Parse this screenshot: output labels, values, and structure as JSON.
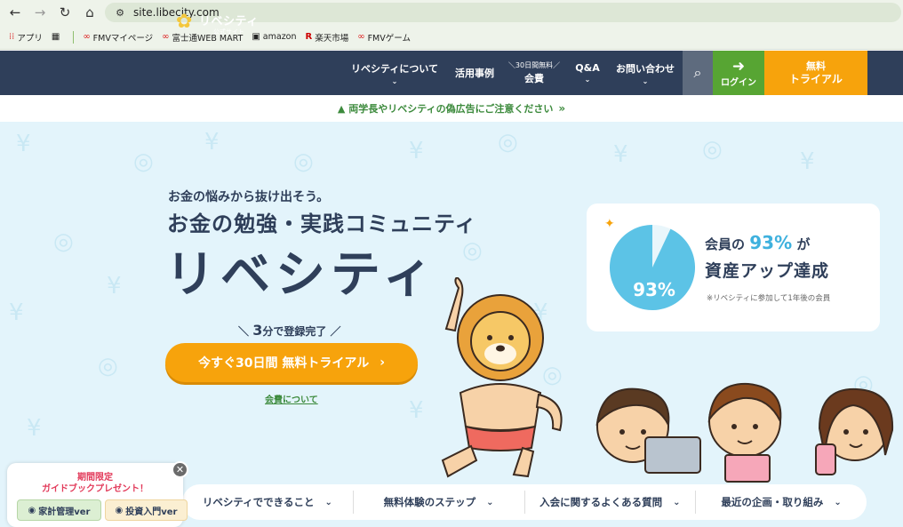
{
  "browser": {
    "url": "site.libecity.com",
    "bookmarks": [
      {
        "label": "アプリ",
        "icon": "apps-grid-icon"
      },
      {
        "label": "",
        "icon": "tab-groups-icon"
      },
      {
        "label": "FMVマイページ",
        "icon": "fmv-icon"
      },
      {
        "label": "富士通WEB MART",
        "icon": "fmv-icon"
      },
      {
        "label": "amazon",
        "icon": "amazon-icon"
      },
      {
        "label": "楽天市場",
        "icon": "rakuten-icon"
      },
      {
        "label": "FMVゲーム",
        "icon": "fmv-icon"
      }
    ]
  },
  "header": {
    "logo_name": "リベシティ",
    "logo_sub": "公式サイト",
    "nav": {
      "about": "リベシティについて",
      "cases": "活用事例",
      "fee_pre": "＼30日間無料／",
      "fee": "会費",
      "qa": "Q&A",
      "contact": "お問い合わせ"
    },
    "login": "ログイン",
    "trial_l1": "無料",
    "trial_l2": "トライアル"
  },
  "warning": {
    "text": "両学長やリベシティの偽広告にご注意ください"
  },
  "hero": {
    "tagline": "お金の悩みから抜け出そう。",
    "headline": "お金の勉強・実践コミュニティ",
    "title": "リベシティ",
    "reg_num": "3",
    "reg_text": "分で登録完了",
    "cta": "今すぐ30日間 無料トライアル",
    "fee_link": "会費について"
  },
  "stat": {
    "pie_label": "93%",
    "line1_pre": "会員の",
    "line1_pct": "93%",
    "line1_post": "が",
    "line2": "資産アップ達成",
    "note": "※リベシティに参加して1年後の会員",
    "value": 0.93
  },
  "bottom_nav": [
    "リベシティでできること",
    "無料体験のステップ",
    "入会に関するよくある質問",
    "最近の企画・取り組み"
  ],
  "popup": {
    "line1": "期間限定",
    "line2": "ガイドブックプレゼント！",
    "btn1": "家計管理ver",
    "btn2": "投資入門ver"
  },
  "colors": {
    "navy": "#2f3f5a",
    "orange": "#f7a30c",
    "green": "#57a533",
    "sky": "#e3f4fb",
    "pie": "#5cc3e6"
  }
}
